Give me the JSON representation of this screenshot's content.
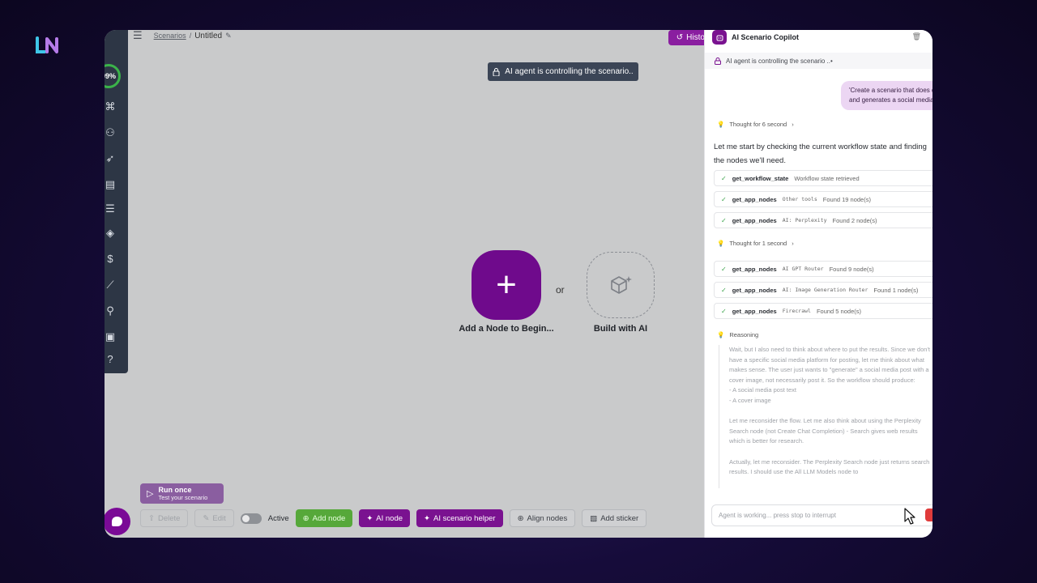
{
  "brand": {
    "logo_text": "LN"
  },
  "left_sidebar": {
    "progress_label": "99%",
    "icons": [
      "workflow-icon",
      "users-icon",
      "rocket-icon",
      "table-icon",
      "list-icon",
      "layers-icon",
      "dollar-icon",
      "chart-icon",
      "user-search-icon",
      "window-icon",
      "help-icon"
    ]
  },
  "header": {
    "breadcrumb_root": "Scenarios",
    "separator": "/",
    "scenario_name": "Untitled",
    "history_label": "History"
  },
  "canvas": {
    "banner": "AI agent is controlling the scenario..",
    "add_node_label": "Add a Node to Begin...",
    "or_label": "or",
    "build_ai_label": "Build with AI"
  },
  "run_once": {
    "title": "Run once",
    "subtitle": "Test your scenario"
  },
  "toolbar": {
    "delete_label": "Delete",
    "edit_label": "Edit",
    "active_label": "Active",
    "add_node_label": "Add node",
    "ai_node_label": "AI node",
    "ai_helper_label": "AI scenario helper",
    "align_label": "Align nodes",
    "sticker_label": "Add sticker"
  },
  "copilot": {
    "title": "AI Scenario Copilot",
    "status": "AI agent is controlling the scenario ..•",
    "user_message": "'Create a scenario that does daily research on automation trends and generates a social media post with a cover image'",
    "thought1": "Thought for 6 second",
    "intro_text": "Let me start by checking the current workflow state and finding the nodes we'll need.",
    "tools_a": [
      {
        "name": "get_workflow_state",
        "arg": "",
        "result": "Workflow state retrieved"
      },
      {
        "name": "get_app_nodes",
        "arg": "Other tools",
        "result": "Found 19 node(s)"
      },
      {
        "name": "get_app_nodes",
        "arg": "AI: Perplexity",
        "result": "Found 2 node(s)"
      }
    ],
    "thought2": "Thought for 1 second",
    "tools_b": [
      {
        "name": "get_app_nodes",
        "arg": "AI GPT Router",
        "result": "Found 9 node(s)"
      },
      {
        "name": "get_app_nodes",
        "arg": "AI: Image Generation Router",
        "result": "Found 1 node(s)"
      },
      {
        "name": "get_app_nodes",
        "arg": "Firecrawl",
        "result": "Found 5 node(s)"
      }
    ],
    "reasoning_title": "Reasoning",
    "reasoning_p1": "Wait, but I also need to think about where to put the results. Since we don't have a specific social media platform for posting, let me think about what makes sense. The user just wants to \"generate\" a social media post with a cover image, not necessarily post it. So the workflow should produce:",
    "reasoning_b1": "- A social media post text",
    "reasoning_b2": "- A cover image",
    "reasoning_p2": "Let me reconsider the flow. Let me also think about using the Perplexity Search node (not Create Chat Completion) - Search gives web results which is better for research.",
    "reasoning_p3": "Actually, let me reconsider. The Perplexity Search node just returns search results. I should use the All LLM Models node to",
    "input_placeholder": "Agent is working... press stop to interrupt"
  },
  "colors": {
    "accent": "#7a1290",
    "success": "#3aa34a",
    "stop": "#e03b3b"
  }
}
